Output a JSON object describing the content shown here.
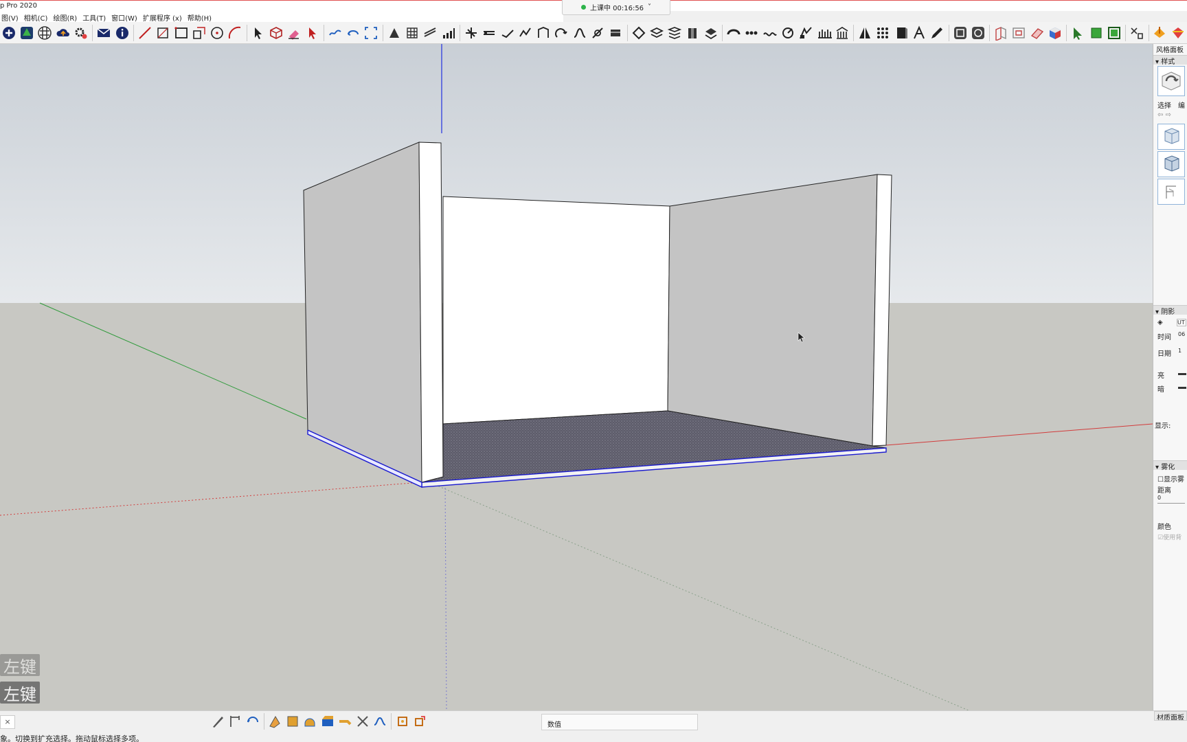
{
  "app": {
    "title": "p Pro 2020"
  },
  "menu": [
    "图(V)",
    "相机(C)",
    "绘图(R)",
    "工具(T)",
    "窗口(W)",
    "扩展程序 (x)",
    "帮助(H)"
  ],
  "session": {
    "label": "上课中 00:16:56",
    "caret": "˅"
  },
  "right_panel": {
    "title": "风格面板",
    "styles_section": "▾ 样式",
    "tab_select": "选择",
    "tab_edit": "编",
    "shadow_section": "▾ 阴影",
    "utc": "UT",
    "time": "时间",
    "time_val": "06",
    "date": "日期",
    "date_val": "1",
    "light": "亮",
    "dark": "暗",
    "display": "显示:",
    "fog_section": "▾ 雾化",
    "show_fog": "显示雾",
    "distance": "距离",
    "dist_zero": "0",
    "color": "颜色",
    "use_bg": "使用背"
  },
  "viewport": {
    "hint_1": "左键",
    "hint_2": "左键"
  },
  "bottom": {
    "status_x": "×",
    "measure_label": "数值",
    "status_text": "象。切换到扩充选择。拖动鼠标选择多项。",
    "materials_tab": "材质面板"
  },
  "colors": {
    "sky_top": "#c9cfd6",
    "ground": "#c8c8c3",
    "wall_shade": "#c4c4c4",
    "floor": "#5d5c6a",
    "axis_red": "#d23b3b",
    "axis_green": "#2e9a3a",
    "axis_blue": "#2030e0",
    "selection": "#1a1ad0"
  }
}
